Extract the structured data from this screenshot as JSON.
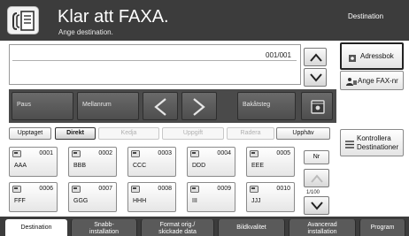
{
  "header": {
    "title": "Klar att FAXA.",
    "subtitle": "Ange destination.",
    "destination_label": "Destination",
    "icon": "fax-document-icon"
  },
  "destination_list": {
    "counter": "001/001"
  },
  "function_bar": {
    "pause": "Paus",
    "space": "Mellanrum",
    "backspace": "Bakåtsteg",
    "prev_icon": "chevron-left-icon",
    "next_icon": "chevron-right-icon",
    "book_icon": "address-book-icon"
  },
  "row_buttons": {
    "busy": "Upptaget",
    "direct": "Direkt",
    "chain": "Kedja",
    "detail": "Uppgift",
    "delete": "Radera",
    "redial": "Upphäv"
  },
  "quick_keys": [
    {
      "num": "0001",
      "name": "AAA"
    },
    {
      "num": "0002",
      "name": "BBB"
    },
    {
      "num": "0003",
      "name": "CCC"
    },
    {
      "num": "0004",
      "name": "DDD"
    },
    {
      "num": "0005",
      "name": "EEE"
    },
    {
      "num": "0006",
      "name": "FFF"
    },
    {
      "num": "0007",
      "name": "GGG"
    },
    {
      "num": "0008",
      "name": "HHH"
    },
    {
      "num": "0009",
      "name": "III"
    },
    {
      "num": "0010",
      "name": "JJJ"
    }
  ],
  "nr_button": "Nr",
  "page_indicator": "1/100",
  "side": {
    "address_book": "Adressbok",
    "enter_fax": "Ange FAX-nr",
    "check_dest_line1": "Kontrollera",
    "check_dest_line2": "Destinationer"
  },
  "tabs": [
    {
      "line1": "Destination",
      "line2": ""
    },
    {
      "line1": "Snabb-",
      "line2": "installation"
    },
    {
      "line1": "Format orig./",
      "line2": "skickade data"
    },
    {
      "line1": "Bildkvalitet",
      "line2": ""
    },
    {
      "line1": "Avancerad",
      "line2": "installation"
    },
    {
      "line1": "Program",
      "line2": ""
    }
  ],
  "colors": {
    "header_bg": "#3c3c3c",
    "func_bar_bg": "#4a4a4a"
  }
}
